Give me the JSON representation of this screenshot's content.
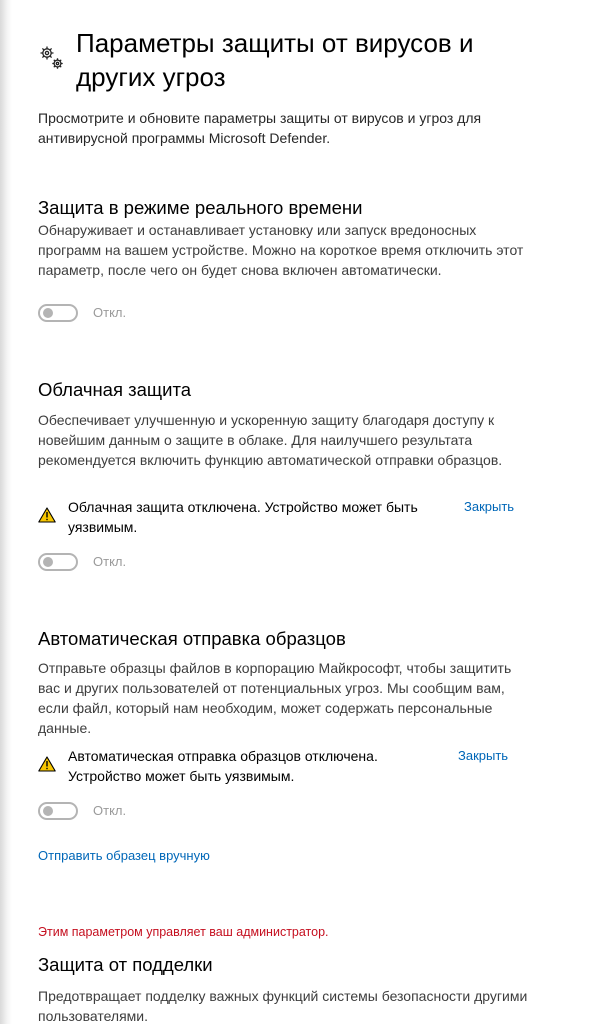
{
  "header": {
    "title": "Параметры защиты от вирусов и других угроз",
    "description": "Просмотрите и обновите параметры защиты от вирусов и угроз для антивирусной программы Microsoft Defender."
  },
  "realtime": {
    "title": "Защита в режиме реального времени",
    "description": "Обнаруживает и останавливает установку или запуск вредоносных программ на вашем устройстве. Можно на короткое время отключить этот параметр, после чего он будет снова включен автоматически.",
    "toggle_label": "Откл.",
    "toggle_on": false
  },
  "cloud": {
    "title": "Облачная защита",
    "description": "Обеспечивает улучшенную и ускоренную защиту благодаря доступу к новейшим данным о защите в облаке. Для наилучшего результата рекомендуется включить функцию автоматической отправки образцов.",
    "warning": "Облачная защита отключена. Устройство может быть уязвимым.",
    "close_label": "Закрыть",
    "toggle_label": "Откл.",
    "toggle_on": false
  },
  "samples": {
    "title": "Автоматическая отправка образцов",
    "description": "Отправьте образцы файлов в корпорацию Майкрософт, чтобы защитить вас и других пользователей от потенциальных угроз. Мы сообщим вам, если файл, который нам необходим, может содержать персональные данные.",
    "warning": "Автоматическая отправка образцов отключена. Устройство может быть уязвимым.",
    "close_label": "Закрыть",
    "toggle_label": "Откл.",
    "toggle_on": false,
    "manual_link": "Отправить образец вручную"
  },
  "tamper": {
    "admin_note": "Этим параметром управляет ваш администратор.",
    "title": "Защита от подделки",
    "description": "Предотвращает подделку важных функций системы безопасности другими пользователями."
  },
  "colors": {
    "accent": "#0067b8",
    "warning": "#f7c600",
    "admin_note": "#c50f1f",
    "toggle_off": "#b4b4b4"
  }
}
